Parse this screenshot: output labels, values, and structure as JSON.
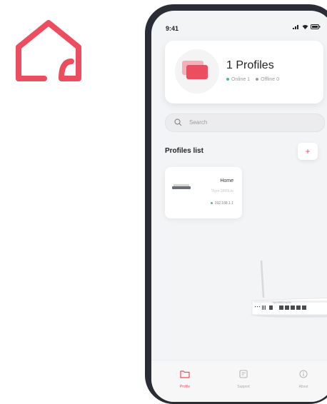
{
  "status_bar": {
    "time": "9:41"
  },
  "summary": {
    "title": "1 Profiles",
    "online": "Online 1",
    "offline": "Offline 0"
  },
  "search": {
    "placeholder": "Search"
  },
  "profiles_section": {
    "title": "Profiles list",
    "add_label": "+"
  },
  "profiles": [
    {
      "name": "Home",
      "model": "Vigor 2865Lte",
      "ip": "192.168.1.1"
    }
  ],
  "router_label": "Vigor2865 DrayTek",
  "tabs": [
    {
      "label": "Profile"
    },
    {
      "label": "Support"
    },
    {
      "label": "About"
    }
  ],
  "colors": {
    "accent": "#ec4d5f",
    "online": "#3fbf9a",
    "offline": "#9a9ca0"
  }
}
